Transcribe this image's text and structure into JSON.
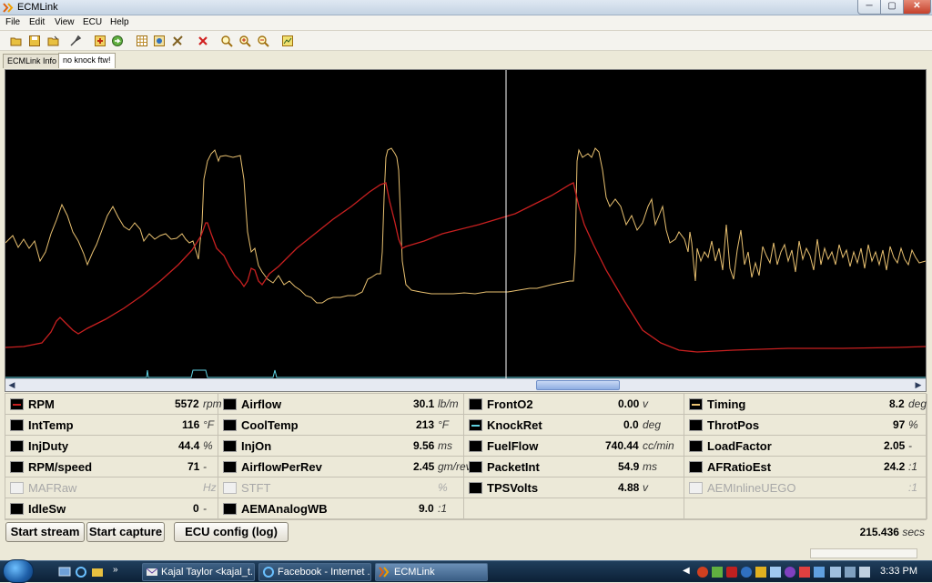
{
  "window": {
    "title": "ECMLink",
    "min": "─",
    "max": "▢",
    "close": "✕"
  },
  "menu": [
    "File",
    "Edit",
    "View",
    "ECU",
    "Help"
  ],
  "tabs": [
    "ECMLink Info",
    "no knock ftw!"
  ],
  "params": [
    {
      "name": "RPM",
      "value": "5572",
      "unit": "rpm",
      "swatch": "#c82020",
      "enabled": true
    },
    {
      "name": "Airflow",
      "value": "30.1",
      "unit": "lb/m",
      "swatch": "",
      "enabled": true
    },
    {
      "name": "FrontO2",
      "value": "0.00",
      "unit": "v",
      "swatch": "",
      "enabled": true
    },
    {
      "name": "Timing",
      "value": "8.2",
      "unit": "deg",
      "swatch": "#e8c070",
      "enabled": true
    },
    {
      "name": "IntTemp",
      "value": "116",
      "unit": "°F",
      "swatch": "",
      "enabled": true
    },
    {
      "name": "CoolTemp",
      "value": "213",
      "unit": "°F",
      "swatch": "",
      "enabled": true
    },
    {
      "name": "KnockRet",
      "value": "0.0",
      "unit": "deg",
      "swatch": "#5fd0e0",
      "enabled": true
    },
    {
      "name": "ThrotPos",
      "value": "97",
      "unit": "%",
      "swatch": "",
      "enabled": true
    },
    {
      "name": "InjDuty",
      "value": "44.4",
      "unit": "%",
      "swatch": "",
      "enabled": true
    },
    {
      "name": "InjOn",
      "value": "9.56",
      "unit": "ms",
      "swatch": "",
      "enabled": true
    },
    {
      "name": "FuelFlow",
      "value": "740.44",
      "unit": "cc/min",
      "swatch": "",
      "enabled": true
    },
    {
      "name": "LoadFactor",
      "value": "2.05",
      "unit": "-",
      "swatch": "",
      "enabled": true
    },
    {
      "name": "RPM/speed",
      "value": "71",
      "unit": "-",
      "swatch": "",
      "enabled": true
    },
    {
      "name": "AirflowPerRev",
      "value": "2.45",
      "unit": "gm/rev",
      "swatch": "",
      "enabled": true
    },
    {
      "name": "PacketInt",
      "value": "54.9",
      "unit": "ms",
      "swatch": "",
      "enabled": true
    },
    {
      "name": "AFRatioEst",
      "value": "24.2",
      "unit": ":1",
      "swatch": "",
      "enabled": true
    },
    {
      "name": "MAFRaw",
      "value": "",
      "unit": "Hz",
      "swatch": "",
      "enabled": false
    },
    {
      "name": "STFT",
      "value": "",
      "unit": "%",
      "swatch": "",
      "enabled": false
    },
    {
      "name": "TPSVolts",
      "value": "4.88",
      "unit": "v",
      "swatch": "",
      "enabled": true
    },
    {
      "name": "AEMInlineUEGO",
      "value": "",
      "unit": ":1",
      "swatch": "",
      "enabled": false
    },
    {
      "name": "IdleSw",
      "value": "0",
      "unit": "-",
      "swatch": "",
      "enabled": true
    },
    {
      "name": "AEMAnalogWB",
      "value": "9.0",
      "unit": ":1",
      "swatch": "",
      "enabled": true
    }
  ],
  "buttons": {
    "start_stream": "Start stream",
    "start_capture": "Start capture",
    "ecu_config": "ECU config (log)"
  },
  "elapsed": {
    "value": "215.436",
    "unit": "secs"
  },
  "taskbar": {
    "tasks": [
      "Kajal Taylor <kajal_t...",
      "Facebook - Internet ...",
      "ECMLink"
    ],
    "clock": "3:33 PM"
  },
  "colors": {
    "rpm": "#c82020",
    "timing": "#e8c070",
    "knock": "#5fd0e0",
    "cursor": "#ffffff"
  }
}
